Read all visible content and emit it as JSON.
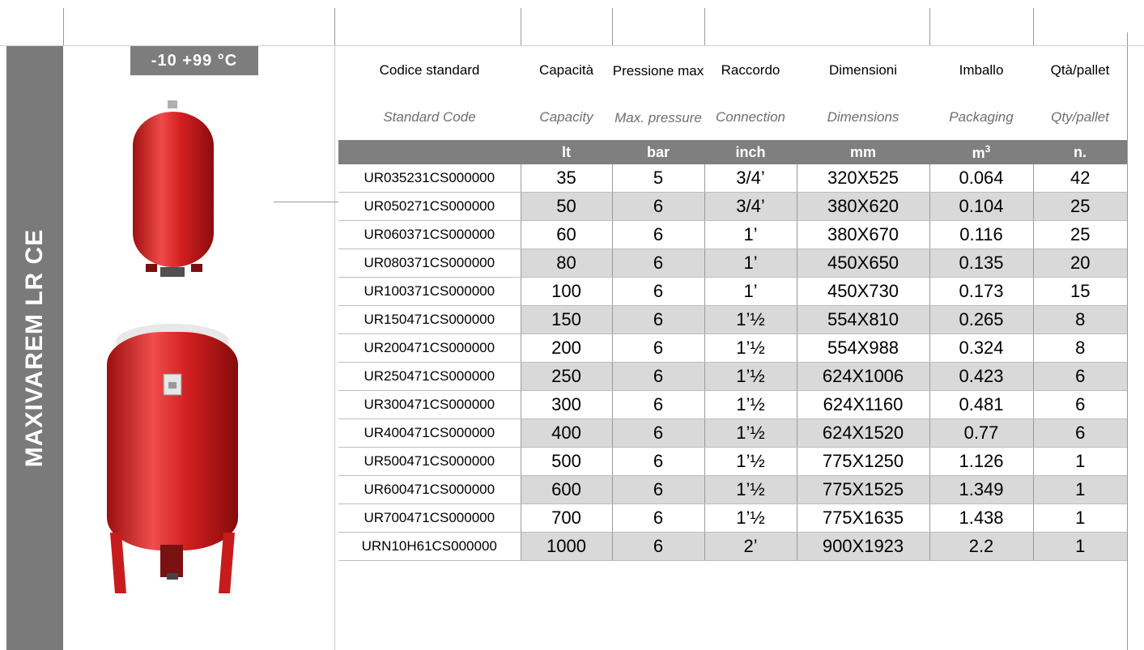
{
  "side_title": "MAXIVAREM LR CE",
  "temperature_badge": "-10  +99  °C",
  "colors": {
    "band": "#7a7a7a",
    "unit_header": "#7f7f7f",
    "row_shade": "#d9d9d9",
    "tank_red": "#d21f1f"
  },
  "images": {
    "small_tank": "red-expansion-vessel-small",
    "large_tank": "red-expansion-vessel-large-with-legs"
  },
  "table": {
    "headers_it": [
      "Codice standard",
      "Capacità",
      "Pressione max",
      "Raccordo",
      "Dimensioni",
      "Imballo",
      "Qtà/pallet"
    ],
    "headers_en": [
      "Standard Code",
      "Capacity",
      "Max. pressure",
      "Connection",
      "Dimensions",
      "Packaging",
      "Qty/pallet"
    ],
    "units": [
      "",
      "lt",
      "bar",
      "inch",
      "mm",
      "m3",
      "n."
    ],
    "rows": [
      {
        "code": "UR035231CS000000",
        "capacity": "35",
        "pressure": "5",
        "connection": "3/4’",
        "dimensions": "320X525",
        "packaging": "0.064",
        "qty": "42"
      },
      {
        "code": "UR050271CS000000",
        "capacity": "50",
        "pressure": "6",
        "connection": "3/4’",
        "dimensions": "380X620",
        "packaging": "0.104",
        "qty": "25"
      },
      {
        "code": "UR060371CS000000",
        "capacity": "60",
        "pressure": "6",
        "connection": "1’",
        "dimensions": "380X670",
        "packaging": "0.116",
        "qty": "25"
      },
      {
        "code": "UR080371CS000000",
        "capacity": "80",
        "pressure": "6",
        "connection": "1’",
        "dimensions": "450X650",
        "packaging": "0.135",
        "qty": "20"
      },
      {
        "code": "UR100371CS000000",
        "capacity": "100",
        "pressure": "6",
        "connection": "1’",
        "dimensions": "450X730",
        "packaging": "0.173",
        "qty": "15"
      },
      {
        "code": "UR150471CS000000",
        "capacity": "150",
        "pressure": "6",
        "connection": "1’½",
        "dimensions": "554X810",
        "packaging": "0.265",
        "qty": "8"
      },
      {
        "code": "UR200471CS000000",
        "capacity": "200",
        "pressure": "6",
        "connection": "1’½",
        "dimensions": "554X988",
        "packaging": "0.324",
        "qty": "8"
      },
      {
        "code": "UR250471CS000000",
        "capacity": "250",
        "pressure": "6",
        "connection": "1’½",
        "dimensions": "624X1006",
        "packaging": "0.423",
        "qty": "6"
      },
      {
        "code": "UR300471CS000000",
        "capacity": "300",
        "pressure": "6",
        "connection": "1’½",
        "dimensions": "624X1160",
        "packaging": "0.481",
        "qty": "6"
      },
      {
        "code": "UR400471CS000000",
        "capacity": "400",
        "pressure": "6",
        "connection": "1’½",
        "dimensions": "624X1520",
        "packaging": "0.77",
        "qty": "6"
      },
      {
        "code": "UR500471CS000000",
        "capacity": "500",
        "pressure": "6",
        "connection": "1’½",
        "dimensions": "775X1250",
        "packaging": "1.126",
        "qty": "1"
      },
      {
        "code": "UR600471CS000000",
        "capacity": "600",
        "pressure": "6",
        "connection": "1’½",
        "dimensions": "775X1525",
        "packaging": "1.349",
        "qty": "1"
      },
      {
        "code": "UR700471CS000000",
        "capacity": "700",
        "pressure": "6",
        "connection": "1’½",
        "dimensions": "775X1635",
        "packaging": "1.438",
        "qty": "1"
      },
      {
        "code": "URN10H61CS000000",
        "capacity": "1000",
        "pressure": "6",
        "connection": "2’",
        "dimensions": "900X1923",
        "packaging": "2.2",
        "qty": "1"
      }
    ]
  }
}
